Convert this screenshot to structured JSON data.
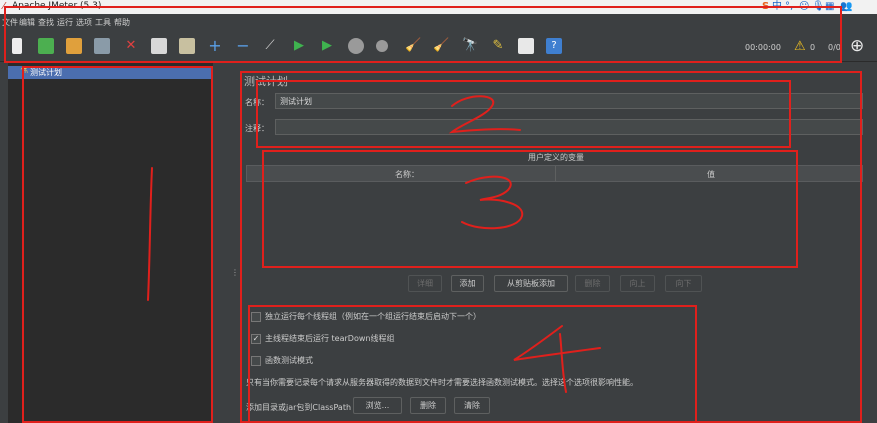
{
  "window": {
    "title": "Apache JMeter (5.3)"
  },
  "menu": [
    "文件",
    "编辑",
    "查找",
    "运行",
    "选项",
    "工具",
    "帮助"
  ],
  "toolbar": {
    "timer": "00:00:00",
    "warnings": "0",
    "threads": "0/0"
  },
  "tree": {
    "selected": "测试计划"
  },
  "testplan": {
    "heading": "测试计划",
    "name_label": "名称：",
    "name_value": "测试计划",
    "comment_label": "注释：",
    "comment_value": ""
  },
  "udv": {
    "title": "用户定义的变量",
    "col_name": "名称：",
    "col_value": "值",
    "buttons": {
      "detail": "详细",
      "add": "添加",
      "add_clipboard": "从剪贴板添加",
      "delete": "删除",
      "up": "向上",
      "down": "向下"
    }
  },
  "options": {
    "serialize": "独立运行每个线程组（例如在一个组运行结束后启动下一个）",
    "teardown": "主线程结束后运行 tearDown线程组",
    "functional": "函数测试模式",
    "note": "只有当你需要记录每个请求从服务器取得的数据到文件时才需要选择函数测试模式。选择这个选项很影响性能。",
    "classpath_label": "添加目录或jar包到ClassPath",
    "browse": "浏览...",
    "delete": "删除",
    "clear": "清除"
  },
  "annotations": {
    "n1": "1",
    "n2": "2",
    "n3": "3",
    "n4": "4"
  },
  "colors": {
    "annotation": "#e0201c",
    "selection": "#4b6eaf",
    "background": "#3c3f41"
  }
}
